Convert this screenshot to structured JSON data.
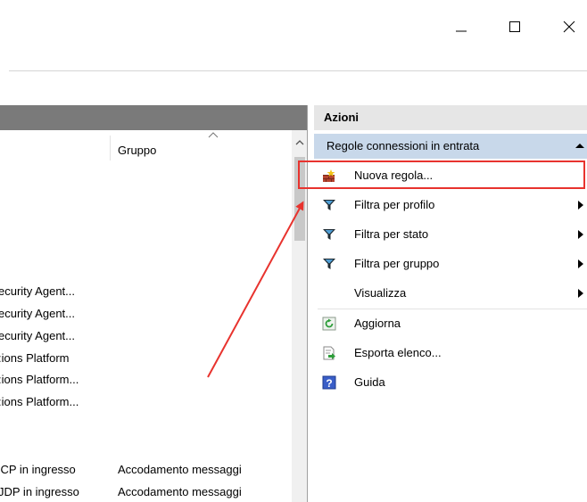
{
  "window": {
    "minimize_icon": "minimize-icon",
    "maximize_icon": "maximize-icon",
    "close_icon": "close-icon"
  },
  "left_panel": {
    "header_title": "",
    "columns": [
      "Gruppo"
    ],
    "rows": [
      {
        "name": "ecurity Agent...",
        "group": ""
      },
      {
        "name": "ecurity Agent...",
        "group": ""
      },
      {
        "name": "ecurity Agent...",
        "group": ""
      },
      {
        "name": ":ions Platform",
        "group": ""
      },
      {
        "name": ":ions Platform...",
        "group": ""
      },
      {
        "name": ":ions Platform...",
        "group": ""
      },
      {
        "name": "'CP in ingresso",
        "group": "Accodamento messaggi"
      },
      {
        "name": "JDP in ingresso",
        "group": "Accodamento messaggi"
      }
    ]
  },
  "actions_panel": {
    "title": "Azioni",
    "section": "Regole connessioni in entrata",
    "items": [
      {
        "label": "Nuova regola...",
        "icon": "new-rule-icon",
        "has_submenu": false
      },
      {
        "label": "Filtra per profilo",
        "icon": "filter-icon",
        "has_submenu": true
      },
      {
        "label": "Filtra per stato",
        "icon": "filter-icon",
        "has_submenu": true
      },
      {
        "label": "Filtra per gruppo",
        "icon": "filter-icon",
        "has_submenu": true
      },
      {
        "label": "Visualizza",
        "icon": "",
        "has_submenu": true
      },
      {
        "label": "Aggiorna",
        "icon": "refresh-icon",
        "has_submenu": false
      },
      {
        "label": "Esporta elenco...",
        "icon": "export-icon",
        "has_submenu": false
      },
      {
        "label": "Guida",
        "icon": "help-icon",
        "has_submenu": false
      }
    ]
  },
  "annotation": {
    "color": "#e8332e"
  }
}
